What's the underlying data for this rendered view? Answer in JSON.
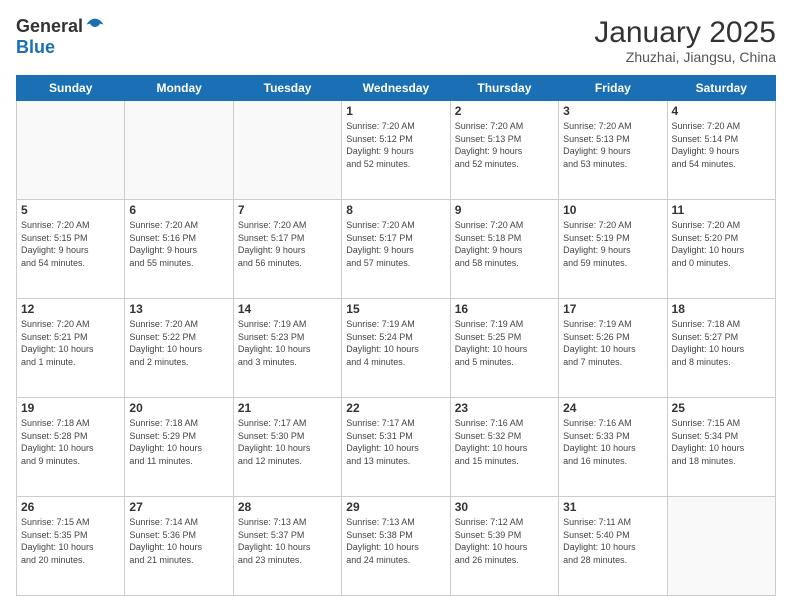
{
  "header": {
    "logo_line1": "General",
    "logo_line2": "Blue",
    "month_title": "January 2025",
    "location": "Zhuzhai, Jiangsu, China"
  },
  "days_of_week": [
    "Sunday",
    "Monday",
    "Tuesday",
    "Wednesday",
    "Thursday",
    "Friday",
    "Saturday"
  ],
  "weeks": [
    [
      {
        "day": "",
        "info": ""
      },
      {
        "day": "",
        "info": ""
      },
      {
        "day": "",
        "info": ""
      },
      {
        "day": "1",
        "info": "Sunrise: 7:20 AM\nSunset: 5:12 PM\nDaylight: 9 hours\nand 52 minutes."
      },
      {
        "day": "2",
        "info": "Sunrise: 7:20 AM\nSunset: 5:13 PM\nDaylight: 9 hours\nand 52 minutes."
      },
      {
        "day": "3",
        "info": "Sunrise: 7:20 AM\nSunset: 5:13 PM\nDaylight: 9 hours\nand 53 minutes."
      },
      {
        "day": "4",
        "info": "Sunrise: 7:20 AM\nSunset: 5:14 PM\nDaylight: 9 hours\nand 54 minutes."
      }
    ],
    [
      {
        "day": "5",
        "info": "Sunrise: 7:20 AM\nSunset: 5:15 PM\nDaylight: 9 hours\nand 54 minutes."
      },
      {
        "day": "6",
        "info": "Sunrise: 7:20 AM\nSunset: 5:16 PM\nDaylight: 9 hours\nand 55 minutes."
      },
      {
        "day": "7",
        "info": "Sunrise: 7:20 AM\nSunset: 5:17 PM\nDaylight: 9 hours\nand 56 minutes."
      },
      {
        "day": "8",
        "info": "Sunrise: 7:20 AM\nSunset: 5:17 PM\nDaylight: 9 hours\nand 57 minutes."
      },
      {
        "day": "9",
        "info": "Sunrise: 7:20 AM\nSunset: 5:18 PM\nDaylight: 9 hours\nand 58 minutes."
      },
      {
        "day": "10",
        "info": "Sunrise: 7:20 AM\nSunset: 5:19 PM\nDaylight: 9 hours\nand 59 minutes."
      },
      {
        "day": "11",
        "info": "Sunrise: 7:20 AM\nSunset: 5:20 PM\nDaylight: 10 hours\nand 0 minutes."
      }
    ],
    [
      {
        "day": "12",
        "info": "Sunrise: 7:20 AM\nSunset: 5:21 PM\nDaylight: 10 hours\nand 1 minute."
      },
      {
        "day": "13",
        "info": "Sunrise: 7:20 AM\nSunset: 5:22 PM\nDaylight: 10 hours\nand 2 minutes."
      },
      {
        "day": "14",
        "info": "Sunrise: 7:19 AM\nSunset: 5:23 PM\nDaylight: 10 hours\nand 3 minutes."
      },
      {
        "day": "15",
        "info": "Sunrise: 7:19 AM\nSunset: 5:24 PM\nDaylight: 10 hours\nand 4 minutes."
      },
      {
        "day": "16",
        "info": "Sunrise: 7:19 AM\nSunset: 5:25 PM\nDaylight: 10 hours\nand 5 minutes."
      },
      {
        "day": "17",
        "info": "Sunrise: 7:19 AM\nSunset: 5:26 PM\nDaylight: 10 hours\nand 7 minutes."
      },
      {
        "day": "18",
        "info": "Sunrise: 7:18 AM\nSunset: 5:27 PM\nDaylight: 10 hours\nand 8 minutes."
      }
    ],
    [
      {
        "day": "19",
        "info": "Sunrise: 7:18 AM\nSunset: 5:28 PM\nDaylight: 10 hours\nand 9 minutes."
      },
      {
        "day": "20",
        "info": "Sunrise: 7:18 AM\nSunset: 5:29 PM\nDaylight: 10 hours\nand 11 minutes."
      },
      {
        "day": "21",
        "info": "Sunrise: 7:17 AM\nSunset: 5:30 PM\nDaylight: 10 hours\nand 12 minutes."
      },
      {
        "day": "22",
        "info": "Sunrise: 7:17 AM\nSunset: 5:31 PM\nDaylight: 10 hours\nand 13 minutes."
      },
      {
        "day": "23",
        "info": "Sunrise: 7:16 AM\nSunset: 5:32 PM\nDaylight: 10 hours\nand 15 minutes."
      },
      {
        "day": "24",
        "info": "Sunrise: 7:16 AM\nSunset: 5:33 PM\nDaylight: 10 hours\nand 16 minutes."
      },
      {
        "day": "25",
        "info": "Sunrise: 7:15 AM\nSunset: 5:34 PM\nDaylight: 10 hours\nand 18 minutes."
      }
    ],
    [
      {
        "day": "26",
        "info": "Sunrise: 7:15 AM\nSunset: 5:35 PM\nDaylight: 10 hours\nand 20 minutes."
      },
      {
        "day": "27",
        "info": "Sunrise: 7:14 AM\nSunset: 5:36 PM\nDaylight: 10 hours\nand 21 minutes."
      },
      {
        "day": "28",
        "info": "Sunrise: 7:13 AM\nSunset: 5:37 PM\nDaylight: 10 hours\nand 23 minutes."
      },
      {
        "day": "29",
        "info": "Sunrise: 7:13 AM\nSunset: 5:38 PM\nDaylight: 10 hours\nand 24 minutes."
      },
      {
        "day": "30",
        "info": "Sunrise: 7:12 AM\nSunset: 5:39 PM\nDaylight: 10 hours\nand 26 minutes."
      },
      {
        "day": "31",
        "info": "Sunrise: 7:11 AM\nSunset: 5:40 PM\nDaylight: 10 hours\nand 28 minutes."
      },
      {
        "day": "",
        "info": ""
      }
    ]
  ]
}
